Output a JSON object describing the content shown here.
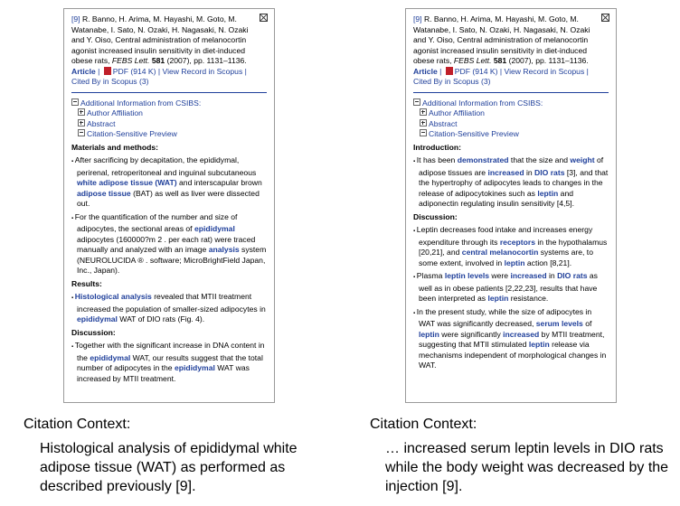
{
  "panels": [
    {
      "ref_num": "[9]",
      "citation_authors": "R. Banno, H. Arima, M. Hayashi, M. Goto, M. Watanabe, I. Sato, N. Ozaki, H. Nagasaki, N. Ozaki and Y. Oiso, Central administration of melanocortin agonist increased insulin sensitivity in diet-induced obese rats,",
      "journal": "FEBS Lett.",
      "volume": "581",
      "year_pages": "(2007), pp. 1131–1136.",
      "link_article": "Article",
      "link_pdf": "PDF (914 K)",
      "link_record": "View Record in Scopus",
      "link_cited": "Cited By in Scopus (3)",
      "additional_info": "Additional Information from CSIBS:",
      "tree_author": "Author Affiliation",
      "tree_abstract": "Abstract",
      "tree_preview": "Citation-Sensitive Preview",
      "sections": [
        {
          "heading": "Materials and methods:",
          "bullets": [
            [
              {
                "t": "After sacrificing by decapitation, the epididymal, perirenal, retroperitoneal and inguinal subcutaneous ",
                "h": false
              },
              {
                "t": "white adipose tissue (WAT)",
                "h": true
              },
              {
                "t": " and interscapular brown ",
                "h": false
              },
              {
                "t": "adipose tissue",
                "h": true
              },
              {
                "t": " (BAT) as well as liver were dissected out.",
                "h": false
              }
            ],
            [
              {
                "t": "For the quantification of the number and size of adipocytes, the sectional areas of ",
                "h": false
              },
              {
                "t": "epididymal",
                "h": true
              },
              {
                "t": " adipocytes (160000?m 2 . per each rat) were traced manually and analyzed with an image ",
                "h": false
              },
              {
                "t": "analysis",
                "h": true
              },
              {
                "t": " system (NEUROLUCIDA ® . software; MicroBrightField Japan, Inc., Japan).",
                "h": false
              }
            ]
          ]
        },
        {
          "heading": "Results:",
          "bullets": [
            [
              {
                "t": "Histological analysis",
                "h": true
              },
              {
                "t": " revealed that MTII treatment increased the population of smaller-sized adipocytes in ",
                "h": false
              },
              {
                "t": "epididymal",
                "h": true
              },
              {
                "t": " WAT of DIO rats (Fig. 4).",
                "h": false
              }
            ]
          ]
        },
        {
          "heading": "Discussion:",
          "bullets": [
            [
              {
                "t": "Together with the significant increase in DNA content in the ",
                "h": false
              },
              {
                "t": "epididymal",
                "h": true
              },
              {
                "t": " WAT, our results suggest that the total number of adipocytes in the ",
                "h": false
              },
              {
                "t": "epididymal",
                "h": true
              },
              {
                "t": " WAT was increased by MTII treatment.",
                "h": false
              }
            ]
          ]
        }
      ],
      "caption_title": "Citation Context:",
      "caption_body": "Histological analysis of epididymal white adipose tissue (WAT) as performed as described previously [9]."
    },
    {
      "ref_num": "[9]",
      "citation_authors": "R. Banno, H. Arima, M. Hayashi, M. Goto, M. Watanabe, I. Sato, N. Ozaki, H. Nagasaki, N. Ozaki and Y. Oiso, Central administration of melanocortin agonist increased insulin sensitivity in diet-induced obese rats,",
      "journal": "FEBS Lett.",
      "volume": "581",
      "year_pages": "(2007), pp. 1131–1136.",
      "link_article": "Article",
      "link_pdf": "PDF (914 K)",
      "link_record": "View Record in Scopus",
      "link_cited": "Cited By in Scopus (3)",
      "additional_info": "Additional Information from CSIBS:",
      "tree_author": "Author Affiliation",
      "tree_abstract": "Abstract",
      "tree_preview": "Citation-Sensitive Preview",
      "sections": [
        {
          "heading": "Introduction:",
          "bullets": [
            [
              {
                "t": "It has been ",
                "h": false
              },
              {
                "t": "demonstrated",
                "h": true
              },
              {
                "t": " that the size and ",
                "h": false
              },
              {
                "t": "weight",
                "h": true
              },
              {
                "t": " of adipose tissues are ",
                "h": false
              },
              {
                "t": "increased",
                "h": true
              },
              {
                "t": " in ",
                "h": false
              },
              {
                "t": "DIO rats",
                "h": true
              },
              {
                "t": " [3], and that the hypertrophy of adipocytes leads to changes in the release of adipocytokines such as ",
                "h": false
              },
              {
                "t": "leptin",
                "h": true
              },
              {
                "t": " and adiponectin regulating insulin sensitivity [4,5].",
                "h": false
              }
            ]
          ]
        },
        {
          "heading": "Discussion:",
          "bullets": [
            [
              {
                "t": "Leptin decreases food intake and increases energy expenditure through its ",
                "h": false
              },
              {
                "t": "receptors",
                "h": true
              },
              {
                "t": " in the hypothalamus [20,21], and ",
                "h": false
              },
              {
                "t": "central melanocortin",
                "h": true
              },
              {
                "t": " systems are, to some extent, involved in ",
                "h": false
              },
              {
                "t": "leptin",
                "h": true
              },
              {
                "t": " action [8,21].",
                "h": false
              }
            ],
            [
              {
                "t": "Plasma ",
                "h": false
              },
              {
                "t": "leptin levels",
                "h": true
              },
              {
                "t": " were ",
                "h": false
              },
              {
                "t": "increased",
                "h": true
              },
              {
                "t": " in ",
                "h": false
              },
              {
                "t": "DIO rats",
                "h": true
              },
              {
                "t": " as well as in obese patients [2,22,23], results that have been interpreted as ",
                "h": false
              },
              {
                "t": "leptin",
                "h": true
              },
              {
                "t": " resistance.",
                "h": false
              }
            ],
            [
              {
                "t": "In the present study, while the size of adipocytes in WAT was significantly decreased, ",
                "h": false
              },
              {
                "t": "serum levels",
                "h": true
              },
              {
                "t": " of ",
                "h": false
              },
              {
                "t": "leptin",
                "h": true
              },
              {
                "t": " were significantly ",
                "h": false
              },
              {
                "t": "increased",
                "h": true
              },
              {
                "t": " by MTII treatment, suggesting that MTII stimulated ",
                "h": false
              },
              {
                "t": "leptin",
                "h": true
              },
              {
                "t": " release via mechanisms independent of morphological changes in WAT.",
                "h": false
              }
            ]
          ]
        }
      ],
      "caption_title": "Citation Context:",
      "caption_body": "… increased serum leptin levels in DIO rats while the body weight was decreased by the injection [9]."
    }
  ]
}
